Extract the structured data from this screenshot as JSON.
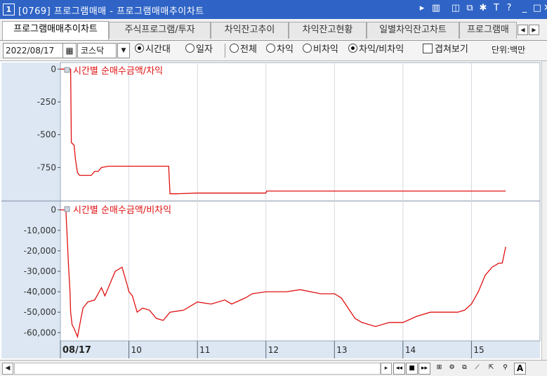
{
  "window": {
    "screen_no": "1",
    "title": "[0769] 프로그램매매 - 프로그램매매추이차트",
    "buttons": [
      "▸",
      "▥",
      "◫",
      "⧉",
      "✱",
      "T",
      "?",
      "_",
      "□",
      "✕"
    ]
  },
  "tabs": [
    "프로그램매매추이차트",
    "주식프로그램/투자",
    "차익잔고추이",
    "차익잔고현황",
    "일별차익잔고차트",
    "프로그램매"
  ],
  "toolbar": {
    "date": "2022/08/17",
    "market": "코스닥",
    "period_options": [
      "시간대",
      "일자"
    ],
    "period_selected": "시간대",
    "type_options": [
      "전체",
      "차익",
      "비차익",
      "차익/비차익"
    ],
    "type_selected": "차익/비차익",
    "overlay_label": "겹쳐보기",
    "unit_label": "단위:백만"
  },
  "chart_data": [
    {
      "type": "line",
      "title": "시간별 순매수금액/차익",
      "color": "#e01010",
      "ylim": [
        -1000,
        50
      ],
      "yticks": [
        0,
        -250,
        -500,
        -750
      ],
      "x": [
        9.0,
        9.1,
        9.15,
        9.16,
        9.2,
        9.22,
        9.25,
        9.28,
        9.3,
        9.35,
        9.4,
        9.45,
        9.5,
        9.55,
        9.6,
        9.7,
        9.8,
        9.9,
        10.0,
        10.1,
        10.2,
        10.3,
        10.4,
        10.5,
        10.58,
        10.6,
        10.7,
        11.0,
        11.5,
        12.0,
        12.01,
        12.5,
        13.0,
        14.0,
        15.0,
        15.5
      ],
      "y": [
        0,
        0,
        0,
        -560,
        -580,
        -690,
        -790,
        -810,
        -810,
        -810,
        -810,
        -810,
        -780,
        -780,
        -750,
        -740,
        -740,
        -740,
        -740,
        -740,
        -740,
        -740,
        -740,
        -740,
        -740,
        -950,
        -950,
        -945,
        -945,
        -945,
        -930,
        -930,
        -930,
        -930,
        -930,
        -930
      ]
    },
    {
      "type": "line",
      "title": "시간별 순매수금액/비차익",
      "color": "#e01010",
      "ylim": [
        -64000,
        4000
      ],
      "yticks": [
        0,
        -10000,
        -20000,
        -30000,
        -40000,
        -50000,
        -60000
      ],
      "x": [
        9.0,
        9.08,
        9.12,
        9.14,
        9.15,
        9.17,
        9.2,
        9.25,
        9.3,
        9.33,
        9.4,
        9.5,
        9.6,
        9.65,
        9.7,
        9.8,
        9.9,
        9.97,
        10.0,
        10.05,
        10.12,
        10.2,
        10.3,
        10.4,
        10.5,
        10.6,
        10.8,
        11.0,
        11.2,
        11.4,
        11.5,
        11.7,
        11.8,
        12.0,
        12.3,
        12.5,
        12.8,
        13.0,
        13.1,
        13.2,
        13.3,
        13.4,
        13.6,
        13.8,
        14.0,
        14.2,
        14.4,
        14.6,
        14.8,
        14.9,
        15.0,
        15.1,
        15.2,
        15.3,
        15.4,
        15.45,
        15.5
      ],
      "x_labels": [
        {
          "x": 9.0,
          "label": "08/17"
        },
        {
          "x": 10.0,
          "label": "10"
        },
        {
          "x": 11.0,
          "label": "11"
        },
        {
          "x": 12.0,
          "label": "12"
        },
        {
          "x": 13.0,
          "label": "13"
        },
        {
          "x": 14.0,
          "label": "14"
        },
        {
          "x": 15.0,
          "label": "15"
        }
      ],
      "y": [
        0,
        0,
        -28000,
        -40000,
        -50000,
        -56000,
        -58000,
        -62000,
        -53000,
        -48000,
        -45000,
        -44000,
        -38000,
        -42000,
        -38000,
        -30000,
        -28000,
        -36000,
        -40000,
        -42000,
        -50000,
        -48000,
        -49000,
        -53000,
        -54000,
        -50000,
        -49000,
        -45000,
        -46000,
        -44000,
        -46000,
        -43000,
        -41000,
        -40000,
        -40000,
        -39000,
        -41000,
        -41000,
        -43000,
        -48000,
        -53000,
        -55000,
        -57000,
        -55000,
        -55000,
        -52000,
        -50000,
        -50000,
        -50000,
        -49000,
        -46000,
        -40000,
        -32000,
        -28000,
        -26000,
        -26000,
        -18000
      ]
    }
  ],
  "bottom_tools": [
    "▸",
    "◂◂",
    "■",
    "▸▸",
    "⊞",
    "⚙",
    "⧉",
    "⟋",
    "⇱",
    "⚲",
    "A"
  ]
}
